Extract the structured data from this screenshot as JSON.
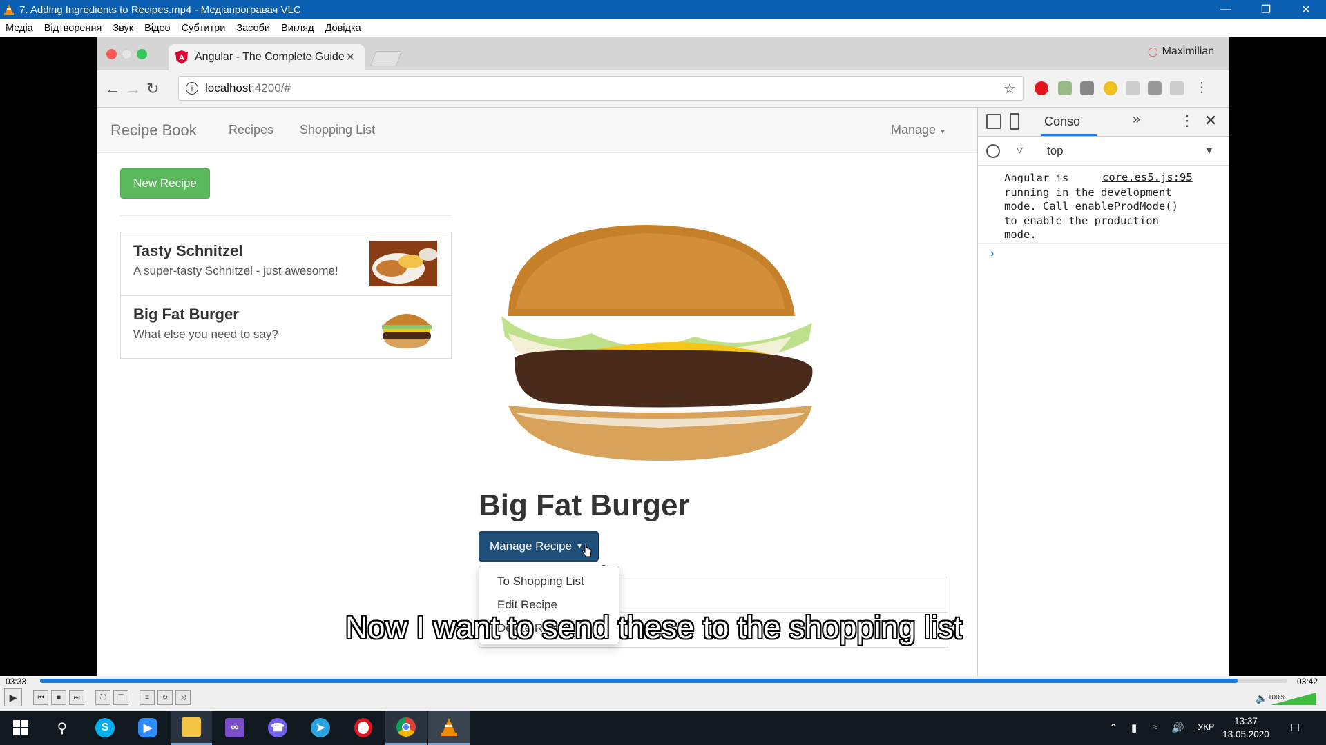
{
  "vlc": {
    "title": "7. Adding Ingredients to Recipes.mp4 - Медіапрогравач VLC",
    "menu": [
      "Медіа",
      "Відтворення",
      "Звук",
      "Відео",
      "Субтитри",
      "Засоби",
      "Вигляд",
      "Довідка"
    ],
    "time_elapsed": "03:33",
    "time_total": "03:42",
    "progress": 0.96,
    "volume_label": "100%",
    "subtitle": "Now I want to send these to the shopping list"
  },
  "browser": {
    "tab_title": "Angular - The Complete Guide",
    "profile_name": "Maximilian",
    "url_host": "localhost",
    "url_path": ":4200/#"
  },
  "app": {
    "brand": "Recipe Book",
    "nav_recipes": "Recipes",
    "nav_shopping": "Shopping List",
    "nav_manage": "Manage",
    "new_recipe": "New Recipe",
    "recipes": [
      {
        "name": "Tasty Schnitzel",
        "description": "A super-tasty Schnitzel - just awesome!"
      },
      {
        "name": "Big Fat Burger",
        "description": "What else you need to say?"
      }
    ],
    "detail_title": "Big Fat Burger",
    "manage_recipe": "Manage Recipe",
    "desc_partial": "y?",
    "dropdown": [
      "To Shopping List",
      "Edit Recipe",
      "Delete Recipe"
    ]
  },
  "devtools": {
    "tab_console": "Conso",
    "context": "top",
    "message": "Angular is\nrunning in the development\nmode. Call enableProdMode()\nto enable the production\nmode.",
    "source": "core.es5.js:95"
  },
  "taskbar": {
    "lang": "УКР",
    "time": "13:37",
    "date": "13.05.2020"
  },
  "colors": {
    "vlc_title": "#0a5fb0",
    "btn_success": "#5cb85c",
    "btn_manage": "#1f4e79",
    "seek": "#1e78d4"
  }
}
